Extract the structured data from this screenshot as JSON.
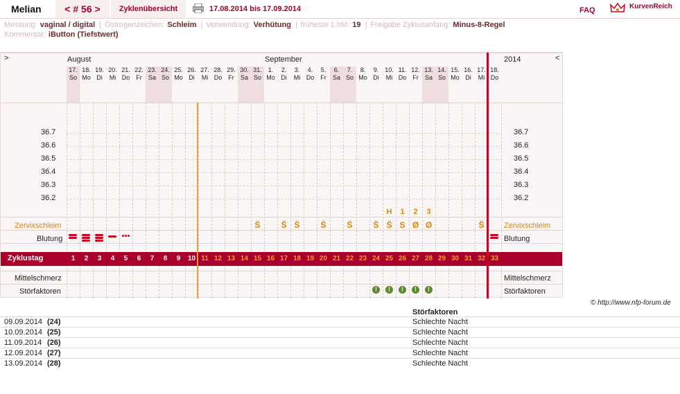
{
  "header": {
    "name": "Melian",
    "cycle_label": "< # 56 >",
    "overview": "Zyklenübersicht",
    "range": "17.08.2014 bis 17.09.2014",
    "faq": "FAQ",
    "logo_text": "KurvenReich"
  },
  "info": {
    "messung_label": "Messung:",
    "messung": "vaginal / digital",
    "oestrogen_label": "Östrogenzeichen:",
    "oestrogen": "Schleim",
    "verwendung_label": "Verwendung:",
    "verwendung": "Verhütung",
    "hm_label": "früheste 1.hM:",
    "hm": "19",
    "freigabe_label": "Freigabe Zyklusanfang:",
    "freigabe": "Minus-8-Regel",
    "kommentar_label": "Kommentar:",
    "kommentar": "iButton (Tiefstwert)"
  },
  "chart": {
    "nav_left": ">",
    "nav_right": "<",
    "month_aug": "August",
    "month_sep": "September",
    "year": "2014",
    "days": [
      {
        "d": "17.",
        "w": "So"
      },
      {
        "d": "18.",
        "w": "Mo"
      },
      {
        "d": "19.",
        "w": "Di"
      },
      {
        "d": "20.",
        "w": "Mi"
      },
      {
        "d": "21.",
        "w": "Do"
      },
      {
        "d": "22.",
        "w": "Fr"
      },
      {
        "d": "23.",
        "w": "Sa"
      },
      {
        "d": "24.",
        "w": "So"
      },
      {
        "d": "25.",
        "w": "Mo"
      },
      {
        "d": "26.",
        "w": "Di"
      },
      {
        "d": "27.",
        "w": "Mi"
      },
      {
        "d": "28.",
        "w": "Do"
      },
      {
        "d": "29.",
        "w": "Fr"
      },
      {
        "d": "30.",
        "w": "Sa"
      },
      {
        "d": "31.",
        "w": "So"
      },
      {
        "d": "1.",
        "w": "Mo"
      },
      {
        "d": "2.",
        "w": "Di"
      },
      {
        "d": "3.",
        "w": "Mi"
      },
      {
        "d": "4.",
        "w": "Do"
      },
      {
        "d": "5.",
        "w": "Fr"
      },
      {
        "d": "6.",
        "w": "Sa"
      },
      {
        "d": "7.",
        "w": "So"
      },
      {
        "d": "8.",
        "w": "Mo"
      },
      {
        "d": "9.",
        "w": "Di"
      },
      {
        "d": "10.",
        "w": "Mi"
      },
      {
        "d": "11.",
        "w": "Do"
      },
      {
        "d": "12.",
        "w": "Fr"
      },
      {
        "d": "13.",
        "w": "Sa"
      },
      {
        "d": "14.",
        "w": "So"
      },
      {
        "d": "15.",
        "w": "Mo"
      },
      {
        "d": "16.",
        "w": "Di"
      },
      {
        "d": "17.",
        "w": "Mi"
      },
      {
        "d": "18.",
        "w": "Do"
      }
    ],
    "temps": [
      "36.7",
      "36.6",
      "36.5",
      "36.4",
      "36.3",
      "36.2"
    ],
    "row_zervix": "Zervixschleim",
    "row_blutung": "Blutung",
    "row_zyklustag": "Zyklustag",
    "row_mittelschmerz": "Mittelschmerz",
    "row_stoer": "Störfaktoren",
    "hcount": [
      {
        "day": 24,
        "t": "H"
      },
      {
        "day": 25,
        "t": "1"
      },
      {
        "day": 26,
        "t": "2"
      },
      {
        "day": 27,
        "t": "3"
      }
    ],
    "zervix_marks": [
      {
        "day": 14,
        "t": "S̈"
      },
      {
        "day": 16,
        "t": "S̈"
      },
      {
        "day": 17,
        "t": "S̈"
      },
      {
        "day": 19,
        "t": "S̈"
      },
      {
        "day": 21,
        "t": "S̈"
      },
      {
        "day": 23,
        "t": "S̈"
      },
      {
        "day": 24,
        "t": "S̈"
      },
      {
        "day": 25,
        "t": "S"
      },
      {
        "day": 26,
        "t": "Ø"
      },
      {
        "day": 27,
        "t": "Ø"
      },
      {
        "day": 31,
        "t": "S̈"
      }
    ],
    "bleeding": [
      {
        "day": 0,
        "lines": 2
      },
      {
        "day": 1,
        "lines": 3
      },
      {
        "day": 2,
        "lines": 3
      },
      {
        "day": 3,
        "lines": 1
      },
      {
        "day": 32,
        "lines": 2
      }
    ],
    "spotting_day": 4,
    "stoer_days": [
      23,
      24,
      25,
      26,
      27
    ],
    "cycle_days": [
      "1",
      "2",
      "3",
      "4",
      "5",
      "6",
      "7",
      "8",
      "9",
      "10",
      "11",
      "12",
      "13",
      "14",
      "15",
      "16",
      "17",
      "18",
      "19",
      "20",
      "21",
      "22",
      "23",
      "24",
      "25",
      "26",
      "27",
      "28",
      "29",
      "30",
      "31",
      "32",
      "33"
    ]
  },
  "footer": {
    "copyright": "© http://www.nfp-forum.de",
    "stoer_header": "Störfaktoren",
    "rows": [
      {
        "date": "09.09.2014",
        "num": "(24)",
        "text": "Schlechte Nacht"
      },
      {
        "date": "10.09.2014",
        "num": "(25)",
        "text": "Schlechte Nacht"
      },
      {
        "date": "11.09.2014",
        "num": "(26)",
        "text": "Schlechte Nacht"
      },
      {
        "date": "12.09.2014",
        "num": "(27)",
        "text": "Schlechte Nacht"
      },
      {
        "date": "13.09.2014",
        "num": "(28)",
        "text": "Schlechte Nacht"
      }
    ]
  }
}
